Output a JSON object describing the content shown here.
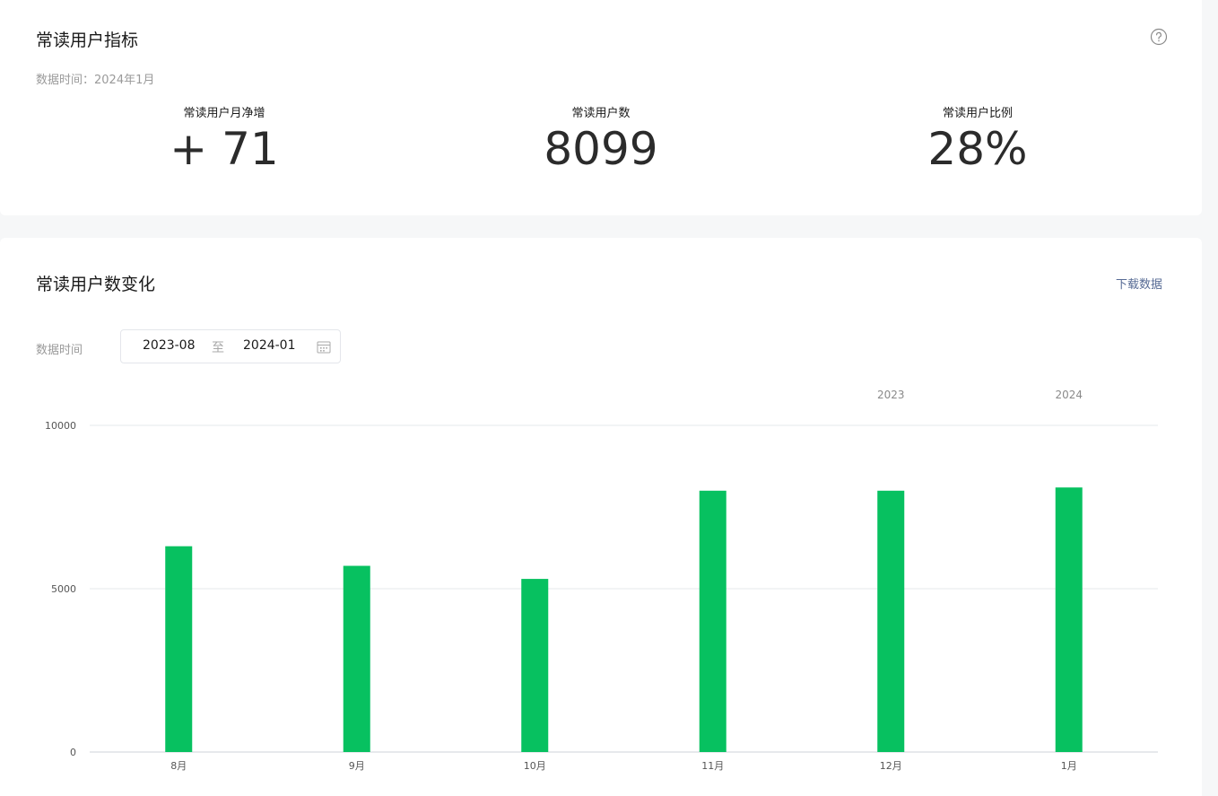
{
  "metrics_card": {
    "title": "常读用户指标",
    "data_time": "数据时间：2024年1月",
    "items": [
      {
        "label": "常读用户月净增",
        "value": "+ 71"
      },
      {
        "label": "常读用户数",
        "value": "8099"
      },
      {
        "label": "常读用户比例",
        "value": "28%"
      }
    ]
  },
  "trend_card": {
    "title": "常读用户数变化",
    "download_label": "下载数据",
    "filter_label": "数据时间",
    "date_start": "2023-08",
    "date_separator": "至",
    "date_end": "2024-01"
  },
  "colors": {
    "bar": "#07c160",
    "link": "#576b95"
  },
  "chart_data": {
    "type": "bar",
    "categories": [
      "8月",
      "9月",
      "10月",
      "11月",
      "12月",
      "1月"
    ],
    "values": [
      6300,
      5700,
      5300,
      8000,
      8000,
      8099
    ],
    "year_labels": [
      {
        "category": "12月",
        "label": "2023"
      },
      {
        "category": "1月",
        "label": "2024"
      }
    ],
    "yticks": [
      0,
      5000,
      10000
    ],
    "ylim": [
      0,
      10000
    ],
    "grid": true,
    "legend": "none"
  }
}
